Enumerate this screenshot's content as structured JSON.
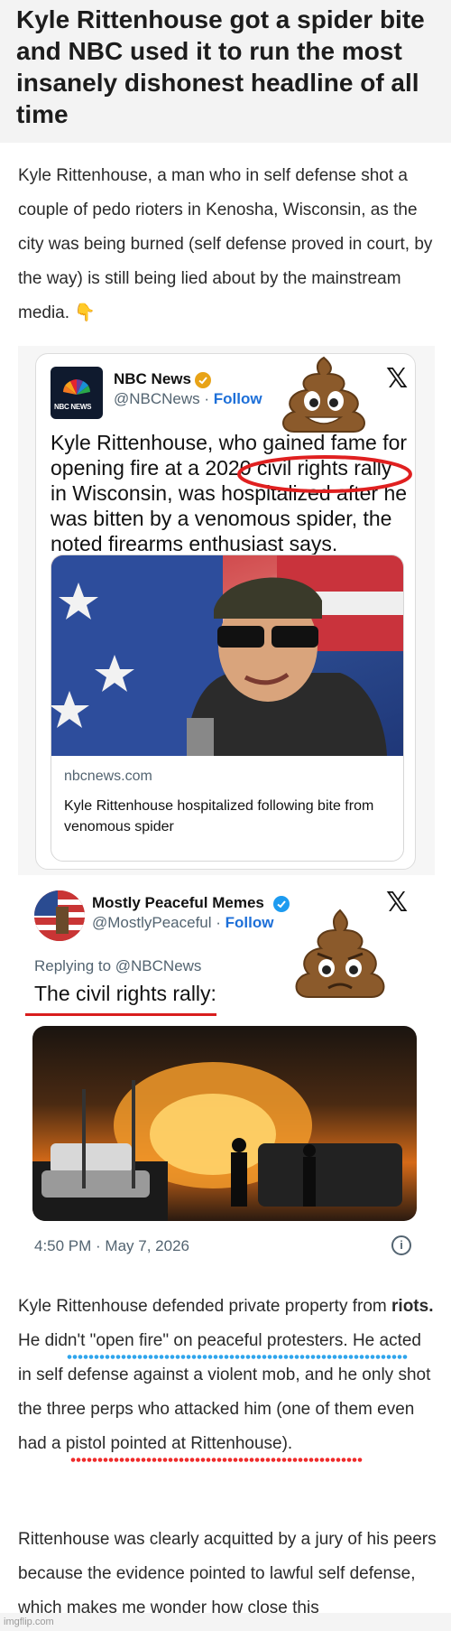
{
  "article": {
    "headline": "Kyle Rittenhouse got a spider bite and NBC used it to run the most insanely dishonest headline of all time",
    "intro_paragraph": "Kyle Rittenhouse, a man who in self defense shot a couple of pedo rioters in Kenosha, Wisconsin, as the city was being burned (self defense proved in court, by the way) is still being lied about by the mainstream media.",
    "intro_emoji": "👇",
    "para2_a": "Kyle Rittenhouse defended private property from ",
    "para2_bold": "riots.",
    "para2_b": " He didn't \"open fire\" on peaceful protesters. He acted in self defense against a violent mob, and he only shot the three perps who attacked him (one of them even had a pistol pointed at Rittenhouse).",
    "para3": "Rittenhouse was clearly acquitted by a jury of his peers because the evidence pointed to lawful self defense, which makes me wonder how close this"
  },
  "tweet1": {
    "author_name": "NBC News",
    "handle": "@NBCNews",
    "separator": " · ",
    "follow_label": "Follow",
    "avatar_label": "NBC NEWS",
    "x_logo": "𝕏",
    "text": "Kyle Rittenhouse, who gained fame for opening fire at a 2020 civil rights rally in Wisconsin, was hospitalized after he was bitten by a venomous spider, the noted firearms enthusiast says.",
    "link_domain": "nbcnews.com",
    "link_title": "Kyle Rittenhouse hospitalized following bite from venomous spider"
  },
  "tweet2": {
    "author_name": "Mostly Peaceful Memes",
    "handle": "@MostlyPeaceful",
    "separator": " · ",
    "follow_label": "Follow",
    "x_logo": "𝕏",
    "replying_to": "Replying to @NBCNews",
    "text": "The civil rights rally:",
    "timestamp": "4:50 PM · May 7, 2026",
    "info_glyph": "i"
  },
  "watermark": "imgflip.com",
  "colors": {
    "verified_nbc": "#e8a317",
    "verified_meme": "#1d9bf0",
    "follow": "#1d6fd8",
    "red_annotation": "#e02020",
    "blue_underline": "#32a6ec"
  }
}
